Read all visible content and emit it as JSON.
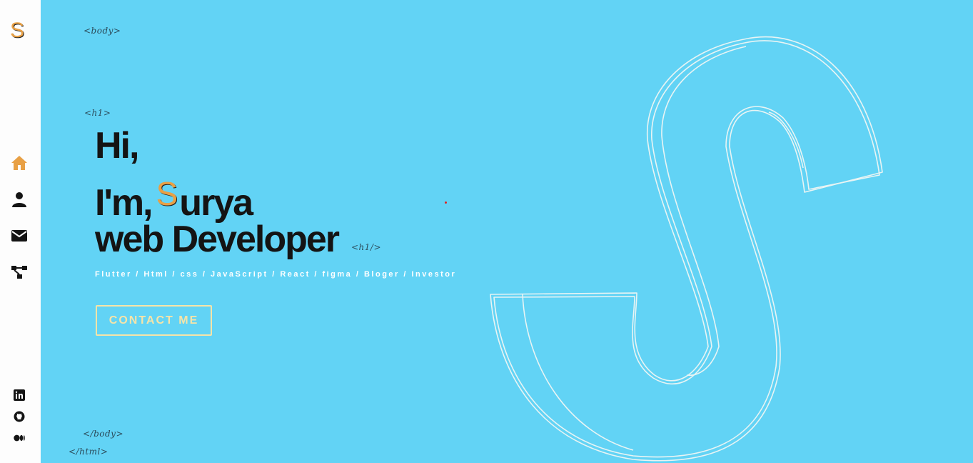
{
  "sidebar": {
    "logo": "S",
    "nav": [
      {
        "icon": "home-icon"
      },
      {
        "icon": "user-icon"
      },
      {
        "icon": "mail-icon"
      },
      {
        "icon": "projects-icon"
      }
    ],
    "social": [
      {
        "icon": "linkedin-icon"
      },
      {
        "icon": "github-icon"
      },
      {
        "icon": "medium-icon"
      }
    ]
  },
  "tags": {
    "body_open": "<body>",
    "h1_open": "<h1>",
    "h1_close": "<h1/>",
    "body_close": "</body>",
    "html_close": "</html>"
  },
  "hero": {
    "line1": "Hi,",
    "line2_prefix": "I'm,",
    "line2_initial": "S",
    "line2_rest": "urya",
    "line3": "web Developer",
    "skills": "Flutter / Html / css / JavaScript / React / figma / Bloger / Investor",
    "contact_label": "CONTACT ME"
  },
  "colors": {
    "background": "#62d3f5",
    "accent": "#e8a045",
    "button": "#f6e4a8",
    "text": "#141414"
  }
}
